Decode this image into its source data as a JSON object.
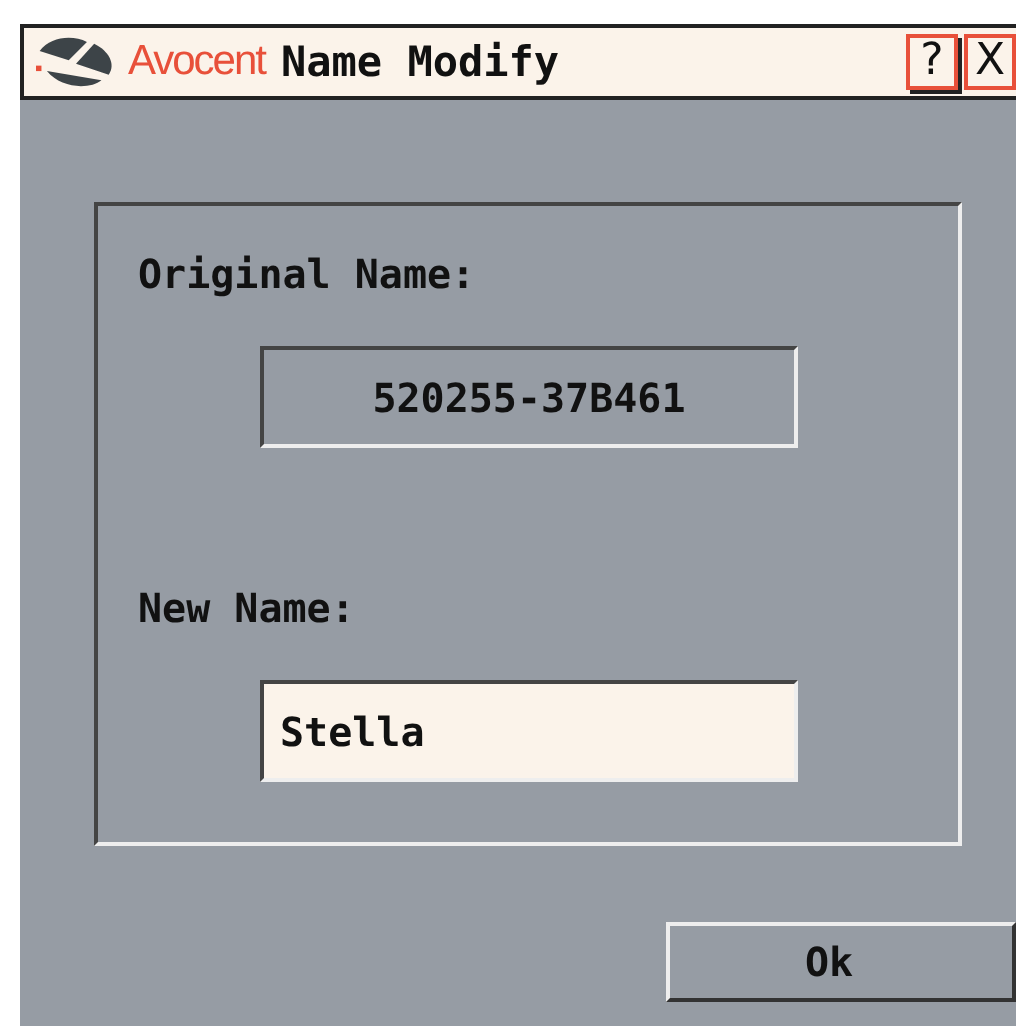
{
  "window": {
    "brand": "Avocent",
    "title": "Name Modify",
    "buttons": [
      {
        "kind": "help",
        "label": "?"
      },
      {
        "kind": "close",
        "label": "X"
      }
    ]
  },
  "form": {
    "fields": [
      {
        "label": "Original Name:",
        "value": "520255-37B461",
        "editable": false
      },
      {
        "label": "New Name:",
        "value": "Stella",
        "editable": true
      }
    ]
  },
  "buttons": [
    "Ok"
  ]
}
